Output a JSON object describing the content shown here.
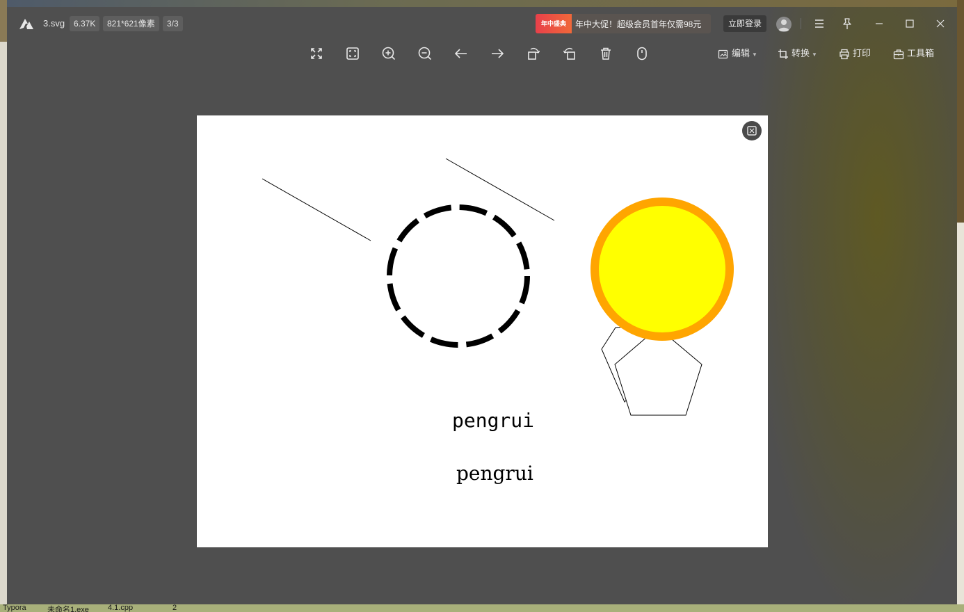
{
  "titlebar": {
    "filename": "3.svg",
    "filesize": "6.37K",
    "dimensions": "821*621像素",
    "index": "3/3",
    "promo_badge": "年中盛典",
    "promo_text": "年中大促！超级会员首年仅需98元",
    "login_label": "立即登录"
  },
  "toolbar": {
    "edit_label": "编辑",
    "convert_label": "转换",
    "print_label": "打印",
    "toolbox_label": "工具箱"
  },
  "image": {
    "text_mono": "pengrui",
    "text_serif": "pengrui",
    "colors": {
      "circle_fill": "#ffff00",
      "circle_stroke": "#ffa500",
      "dashed_stroke": "#000000"
    }
  },
  "taskbar": {
    "items": [
      "Typora",
      "未命名1.exe",
      "4.1.cpp",
      "2"
    ]
  }
}
